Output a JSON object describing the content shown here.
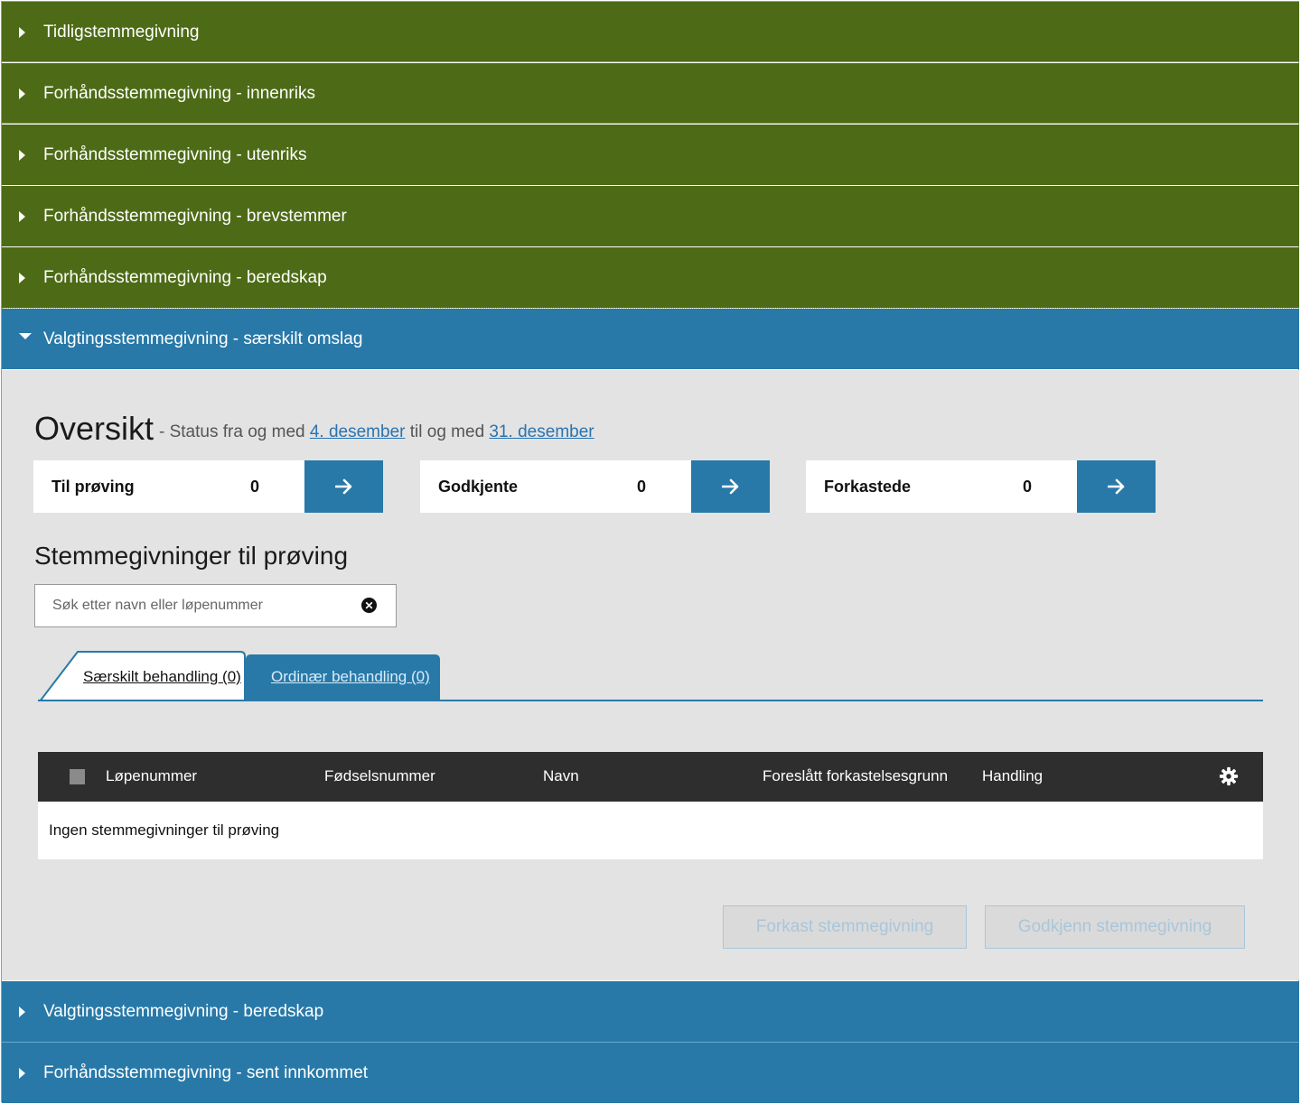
{
  "accordion_top": [
    {
      "label": "Tidligstemmegivning",
      "state": "collapsed"
    },
    {
      "label": "Forhåndsstemmegivning - innenriks",
      "state": "collapsed"
    },
    {
      "label": "Forhåndsstemmegivning - utenriks",
      "state": "collapsed"
    },
    {
      "label": "Forhåndsstemmegivning - brevstemmer",
      "state": "collapsed"
    },
    {
      "label": "Forhåndsstemmegivning - beredskap",
      "state": "collapsed"
    }
  ],
  "accordion_open": {
    "label": "Valgtingsstemmegivning - særskilt omslag",
    "state": "expanded"
  },
  "overview": {
    "title": "Oversikt",
    "status_prefix": "- Status fra og med",
    "date_from": "4. desember",
    "status_middle": "til og med",
    "date_to": "31. desember"
  },
  "stats": [
    {
      "label": "Til prøving",
      "count": "0"
    },
    {
      "label": "Godkjente",
      "count": "0"
    },
    {
      "label": "Forkastede",
      "count": "0"
    }
  ],
  "section_title": "Stemmegivninger til prøving",
  "search": {
    "placeholder": "Søk etter navn eller løpenummer",
    "value": ""
  },
  "tabs": [
    {
      "label": "Særskilt behandling (0)",
      "active": true
    },
    {
      "label": "Ordinær behandling (0)",
      "active": false
    }
  ],
  "table": {
    "columns": [
      "Løpenummer",
      "Fødselsnummer",
      "Navn",
      "Foreslått forkastelsesgrunn",
      "Handling"
    ],
    "empty_message": "Ingen stemmegivninger til prøving"
  },
  "actions": {
    "reject_label": "Forkast stemmegivning",
    "approve_label": "Godkjenn stemmegivning"
  },
  "accordion_bottom": [
    {
      "label": "Valgtingsstemmegivning - beredskap",
      "state": "collapsed"
    },
    {
      "label": "Forhåndsstemmegivning - sent innkommet",
      "state": "collapsed"
    }
  ],
  "colors": {
    "green_header": "#4d6b16",
    "blue_header": "#2879a8",
    "panel_bg": "#e3e3e3",
    "table_header": "#2e2e2e"
  }
}
